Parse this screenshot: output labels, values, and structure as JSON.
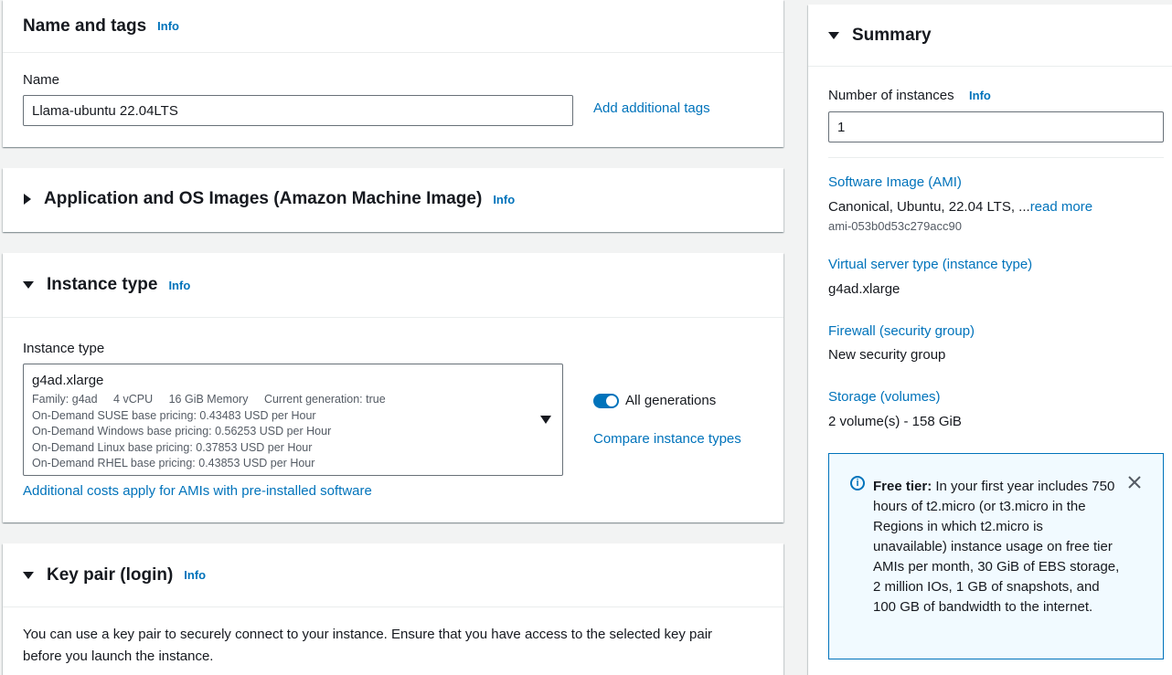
{
  "name_section": {
    "title": "Name and tags",
    "info": "Info",
    "name_label": "Name",
    "name_value": "Llama-ubuntu 22.04LTS",
    "add_tags": "Add additional tags"
  },
  "ami_section": {
    "title": "Application and OS Images (Amazon Machine Image)",
    "info": "Info"
  },
  "instance_section": {
    "title": "Instance type",
    "info": "Info",
    "field_label": "Instance type",
    "selected": "g4ad.xlarge",
    "family": "Family: g4ad",
    "vcpu": "4 vCPU",
    "memory": "16 GiB Memory",
    "current_gen": "Current generation: true",
    "pricing": [
      "On-Demand SUSE base pricing: 0.43483 USD per Hour",
      "On-Demand Windows base pricing: 0.56253 USD per Hour",
      "On-Demand Linux base pricing: 0.37853 USD per Hour",
      "On-Demand RHEL base pricing: 0.43853 USD per Hour"
    ],
    "all_generations": "All generations",
    "compare": "Compare instance types",
    "additional_costs": "Additional costs apply for AMIs with pre-installed software"
  },
  "key_section": {
    "title": "Key pair (login)",
    "info": "Info",
    "description": "You can use a key pair to securely connect to your instance. Ensure that you have access to the selected key pair before you launch the instance."
  },
  "summary": {
    "title": "Summary",
    "instances_label": "Number of instances",
    "info": "Info",
    "instances_value": "1",
    "ami_link": "Software Image (AMI)",
    "ami_value": "Canonical, Ubuntu, 22.04 LTS, ...",
    "ami_read_more": "read more",
    "ami_id": "ami-053b0d53c279acc90",
    "type_link": "Virtual server type (instance type)",
    "type_value": "g4ad.xlarge",
    "firewall_link": "Firewall (security group)",
    "firewall_value": "New security group",
    "storage_link": "Storage (volumes)",
    "storage_value": "2 volume(s) - 158 GiB",
    "free_tier_label": "Free tier:",
    "free_tier_text": " In your first year includes 750 hours of t2.micro (or t3.micro in the Regions in which t2.micro is unavailable) instance usage on free tier AMIs per month, 30 GiB of EBS storage, 2 million IOs, 1 GB of snapshots, and 100 GB of bandwidth to the internet."
  },
  "colors": {
    "link": "#0073bb",
    "toggle_on": "#0073bb",
    "free_tier_bg": "#f1faff"
  }
}
